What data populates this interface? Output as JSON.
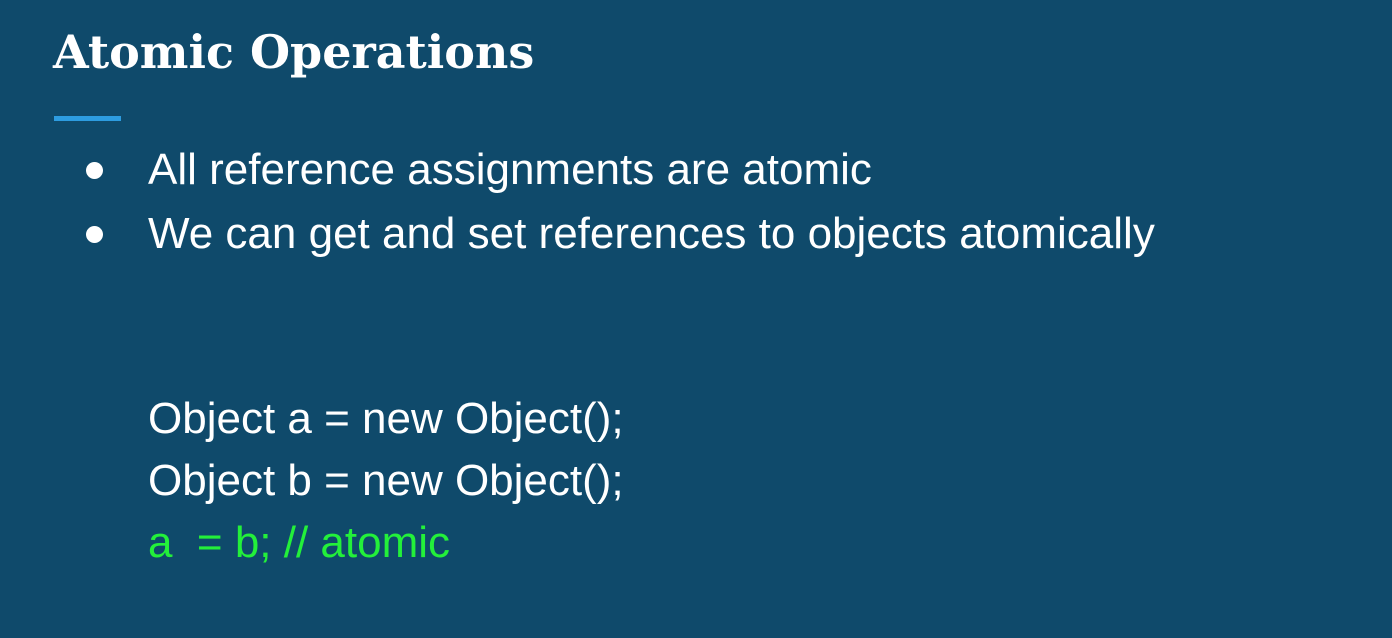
{
  "slide": {
    "title": "Atomic Operations",
    "accent_color": "#2d9ce0",
    "background_color": "#0f4a6b",
    "bullets": [
      "All reference assignments are atomic",
      "We can get and set references to objects atomically"
    ],
    "code_lines": [
      {
        "text": "Object a = new Object();",
        "color": "#ffffff"
      },
      {
        "text": "Object b = new Object();",
        "color": "#ffffff"
      },
      {
        "text": "a  = b; // atomic",
        "color": "#23f03a"
      }
    ]
  }
}
